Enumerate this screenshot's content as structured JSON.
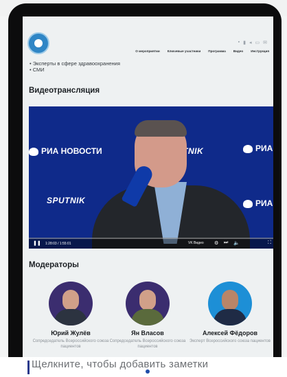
{
  "background": {
    "top_text": "",
    "notes_placeholder": "Щелкните, чтобы добавить заметки"
  },
  "header": {
    "top_icons": [
      "vk-icon",
      "ok-icon",
      "telegram-icon",
      "youtube-icon",
      "email-icon"
    ],
    "nav": [
      "О мероприятии",
      "Ключевые участники",
      "Программа",
      "Видео",
      "Инструкция"
    ]
  },
  "bullets": [
    "Эксперты в сфере здравоохранения",
    "СМИ"
  ],
  "video": {
    "title": "Видеотрансляция",
    "brand_ria": "РИА НОВОСТИ",
    "brand_sputnik": "SPUTNIK",
    "brand_ria_short": "РИА",
    "time": "1:28:03 / 1:55:01",
    "vk_label": "VK Видео"
  },
  "moderators": {
    "title": "Модераторы",
    "items": [
      {
        "name": "Юрий Жулёв",
        "role": "Сопредседатель Всероссийского союза пациентов",
        "bg": "#3b2d6f"
      },
      {
        "name": "Ян Власов",
        "role": "Сопредседатель Всероссийского союза пациентов",
        "bg": "#3b2d6f"
      },
      {
        "name": "Алексей Фёдоров",
        "role": "Эксперт Всероссийского союза пациентов",
        "bg": "#1d8fd6"
      }
    ]
  },
  "colors": {
    "video_bg": "#0f2a8a",
    "accent": "#2f86c6"
  }
}
